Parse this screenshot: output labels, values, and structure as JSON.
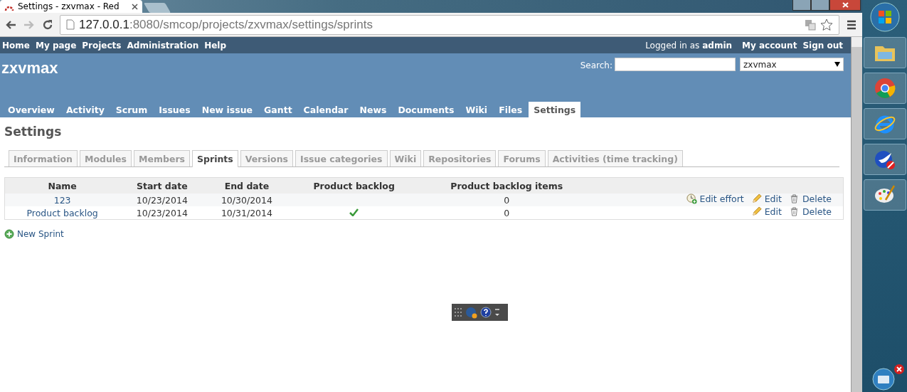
{
  "browser": {
    "tab_title": "Settings - zxvmax - Red",
    "url_host": "127.0.0.1",
    "url_rest": ":8080/smcop/projects/zxvmax/settings/sprints"
  },
  "top_menu": {
    "items": [
      "Home",
      "My page",
      "Projects",
      "Administration",
      "Help"
    ],
    "logged_in_as": "Logged in as",
    "user": "admin",
    "account_links": [
      "My account",
      "Sign out"
    ]
  },
  "header": {
    "project_title": "zxvmax",
    "search_label": "Search:",
    "project_jump": "zxvmax"
  },
  "main_menu": [
    {
      "label": "Overview",
      "selected": false
    },
    {
      "label": "Activity",
      "selected": false
    },
    {
      "label": "Scrum",
      "selected": false
    },
    {
      "label": "Issues",
      "selected": false
    },
    {
      "label": "New issue",
      "selected": false
    },
    {
      "label": "Gantt",
      "selected": false
    },
    {
      "label": "Calendar",
      "selected": false
    },
    {
      "label": "News",
      "selected": false
    },
    {
      "label": "Documents",
      "selected": false
    },
    {
      "label": "Wiki",
      "selected": false
    },
    {
      "label": "Files",
      "selected": false
    },
    {
      "label": "Settings",
      "selected": true
    }
  ],
  "page_title": "Settings",
  "tabs": [
    {
      "label": "Information",
      "selected": false
    },
    {
      "label": "Modules",
      "selected": false
    },
    {
      "label": "Members",
      "selected": false
    },
    {
      "label": "Sprints",
      "selected": true
    },
    {
      "label": "Versions",
      "selected": false
    },
    {
      "label": "Issue categories",
      "selected": false
    },
    {
      "label": "Wiki",
      "selected": false
    },
    {
      "label": "Repositories",
      "selected": false
    },
    {
      "label": "Forums",
      "selected": false
    },
    {
      "label": "Activities (time tracking)",
      "selected": false
    }
  ],
  "table": {
    "columns": [
      "Name",
      "Start date",
      "End date",
      "Product backlog",
      "Product backlog items"
    ],
    "rows": [
      {
        "name": "123",
        "start_date": "10/23/2014",
        "end_date": "10/30/2014",
        "product_backlog": false,
        "items": "0",
        "actions": [
          {
            "kind": "effort",
            "label": "Edit effort"
          },
          {
            "kind": "edit",
            "label": "Edit"
          },
          {
            "kind": "delete",
            "label": "Delete"
          }
        ]
      },
      {
        "name": "Product backlog",
        "start_date": "10/23/2014",
        "end_date": "10/31/2014",
        "product_backlog": true,
        "items": "0",
        "actions": [
          {
            "kind": "edit",
            "label": "Edit"
          },
          {
            "kind": "delete",
            "label": "Delete"
          }
        ]
      }
    ]
  },
  "new_sprint": "New Sprint"
}
